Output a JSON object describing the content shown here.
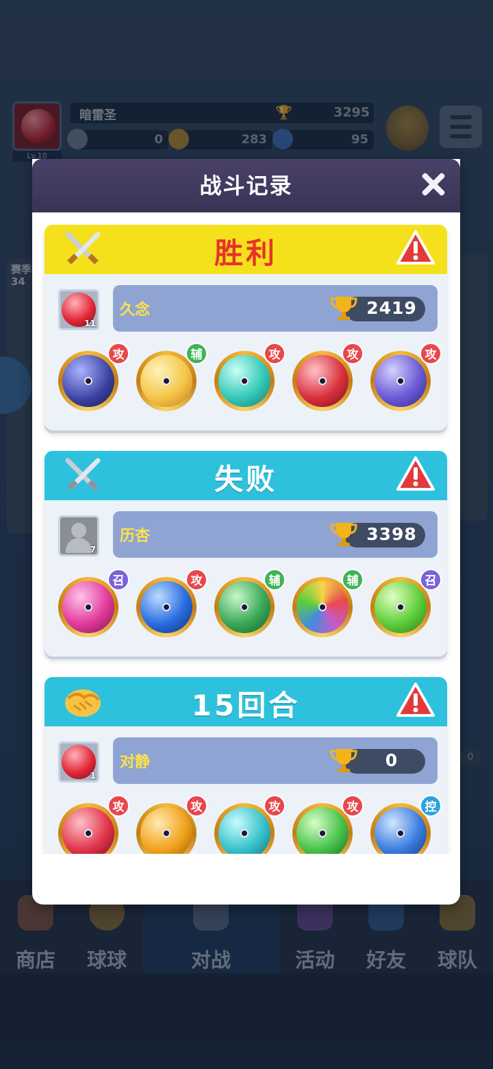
{
  "player": {
    "name": "暗雷圣",
    "level": "Lv.10",
    "trophies": "3295",
    "currency_a": "0",
    "currency_b": "283",
    "currency_c": "95"
  },
  "background": {
    "side_left_text_1": "赛季",
    "side_left_text_2": "34",
    "right_badge": "0"
  },
  "nav": {
    "items": [
      {
        "label": "商店",
        "icon": "shop-icon"
      },
      {
        "label": "球球",
        "icon": "balls-icon"
      },
      {
        "label": "对战",
        "icon": "battle-icon"
      },
      {
        "label": "活动",
        "icon": "event-icon"
      },
      {
        "label": "好友",
        "icon": "friends-icon"
      },
      {
        "label": "球队",
        "icon": "team-icon"
      }
    ],
    "active": "对战"
  },
  "modal": {
    "title": "战斗记录",
    "close_icon": "close-icon"
  },
  "tag_labels": {
    "attack": "攻",
    "support": "辅",
    "summon": "召",
    "control": "控"
  },
  "records": [
    {
      "result": "胜利",
      "result_type": "win",
      "opponent": "久念",
      "level": "11",
      "trophies": "2419",
      "balls": [
        {
          "name": "meteor-ball",
          "tag": "攻",
          "color": "#3a3f9e"
        },
        {
          "name": "pumpkin-ball",
          "tag": "辅",
          "color": "#f4c64a"
        },
        {
          "name": "whirlwind-ball",
          "tag": "攻",
          "color": "#35c9b8"
        },
        {
          "name": "fist-ball",
          "tag": "攻",
          "color": "#d8323e"
        },
        {
          "name": "pixel-ball",
          "tag": "攻",
          "color": "#6a5bd6"
        }
      ]
    },
    {
      "result": "失败",
      "result_type": "lose",
      "opponent": "历杏",
      "level": "7",
      "trophies": "3398",
      "balls": [
        {
          "name": "feather-ball",
          "tag": "召",
          "color": "#e23b9a"
        },
        {
          "name": "vortex-ball",
          "tag": "攻",
          "color": "#2a6ce0"
        },
        {
          "name": "arrow-tree-ball",
          "tag": "辅",
          "color": "#3aa858"
        },
        {
          "name": "rainbow-ball",
          "tag": "辅",
          "color": "#c45cc8"
        },
        {
          "name": "star-circle-ball",
          "tag": "召",
          "color": "#5fce3a"
        }
      ]
    },
    {
      "result": "15回合",
      "result_type": "draw",
      "opponent": "对静",
      "level": "1",
      "trophies": "0",
      "balls": [
        {
          "name": "fire-ball",
          "tag": "攻",
          "color": "#e0354a"
        },
        {
          "name": "lightning-ball",
          "tag": "攻",
          "color": "#f1a21c"
        },
        {
          "name": "wave-ball",
          "tag": "攻",
          "color": "#36c2c9"
        },
        {
          "name": "poison-ball",
          "tag": "攻",
          "color": "#47c24a"
        },
        {
          "name": "snowflake-ball",
          "tag": "控",
          "color": "#3a7de0"
        }
      ]
    }
  ]
}
